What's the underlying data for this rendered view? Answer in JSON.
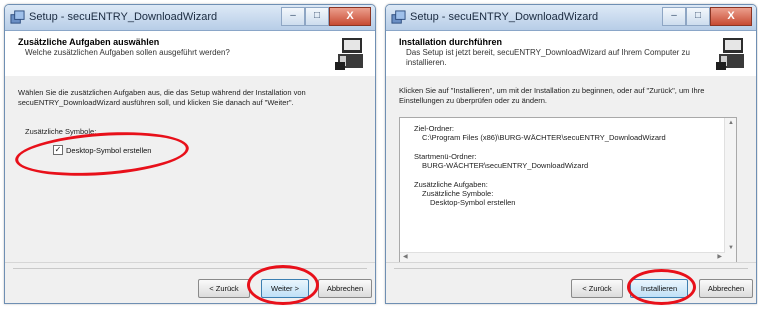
{
  "window_title": "Setup - secuENTRY_DownloadWizard",
  "caption_buttons": {
    "minimize": "–",
    "maximize": "□",
    "close": "X"
  },
  "left": {
    "header_title": "Zusätzliche Aufgaben auswählen",
    "header_subtitle": "Welche zusätzlichen Aufgaben sollen ausgeführt werden?",
    "paragraph": "Wählen Sie die zusätzlichen Aufgaben aus, die das Setup während der Installation von secuENTRY_DownloadWizard ausführen soll, und klicken Sie danach auf \"Weiter\".",
    "group_label": "Zusätzliche Symbole:",
    "checkbox_label": "Desktop-Symbol erstellen",
    "checkbox_mark": "✓",
    "btn_back": "< Zurück",
    "btn_next": "Weiter >",
    "btn_cancel": "Abbrechen"
  },
  "right": {
    "header_title": "Installation durchführen",
    "header_subtitle": "Das Setup ist jetzt bereit, secuENTRY_DownloadWizard auf Ihrem Computer zu installieren.",
    "paragraph": "Klicken Sie auf \"Installieren\", um mit der Installation zu beginnen, oder auf \"Zurück\", um Ihre Einstellungen zu überprüfen oder zu ändern.",
    "memo": {
      "dest_label": "Ziel-Ordner:",
      "dest_value": "C:\\Program Files (x86)\\BURG-WÄCHTER\\secuENTRY_DownloadWizard",
      "start_label": "Startmenü-Ordner:",
      "start_value": "BURG-WÄCHTER\\secuENTRY_DownloadWizard",
      "tasks_label": "Zusätzliche Aufgaben:",
      "tasks_sub": "Zusätzliche Symbole:",
      "tasks_item": "Desktop-Symbol erstellen"
    },
    "btn_back": "< Zurück",
    "btn_install": "Installieren",
    "btn_cancel": "Abbrechen"
  },
  "colors": {
    "highlight": "#e8101a",
    "title_bar": "#c9daef"
  },
  "icons": [
    "setup-icon",
    "installer-computer-icon",
    "scroll-up-icon",
    "scroll-down-icon",
    "scroll-left-icon",
    "scroll-right-icon"
  ]
}
